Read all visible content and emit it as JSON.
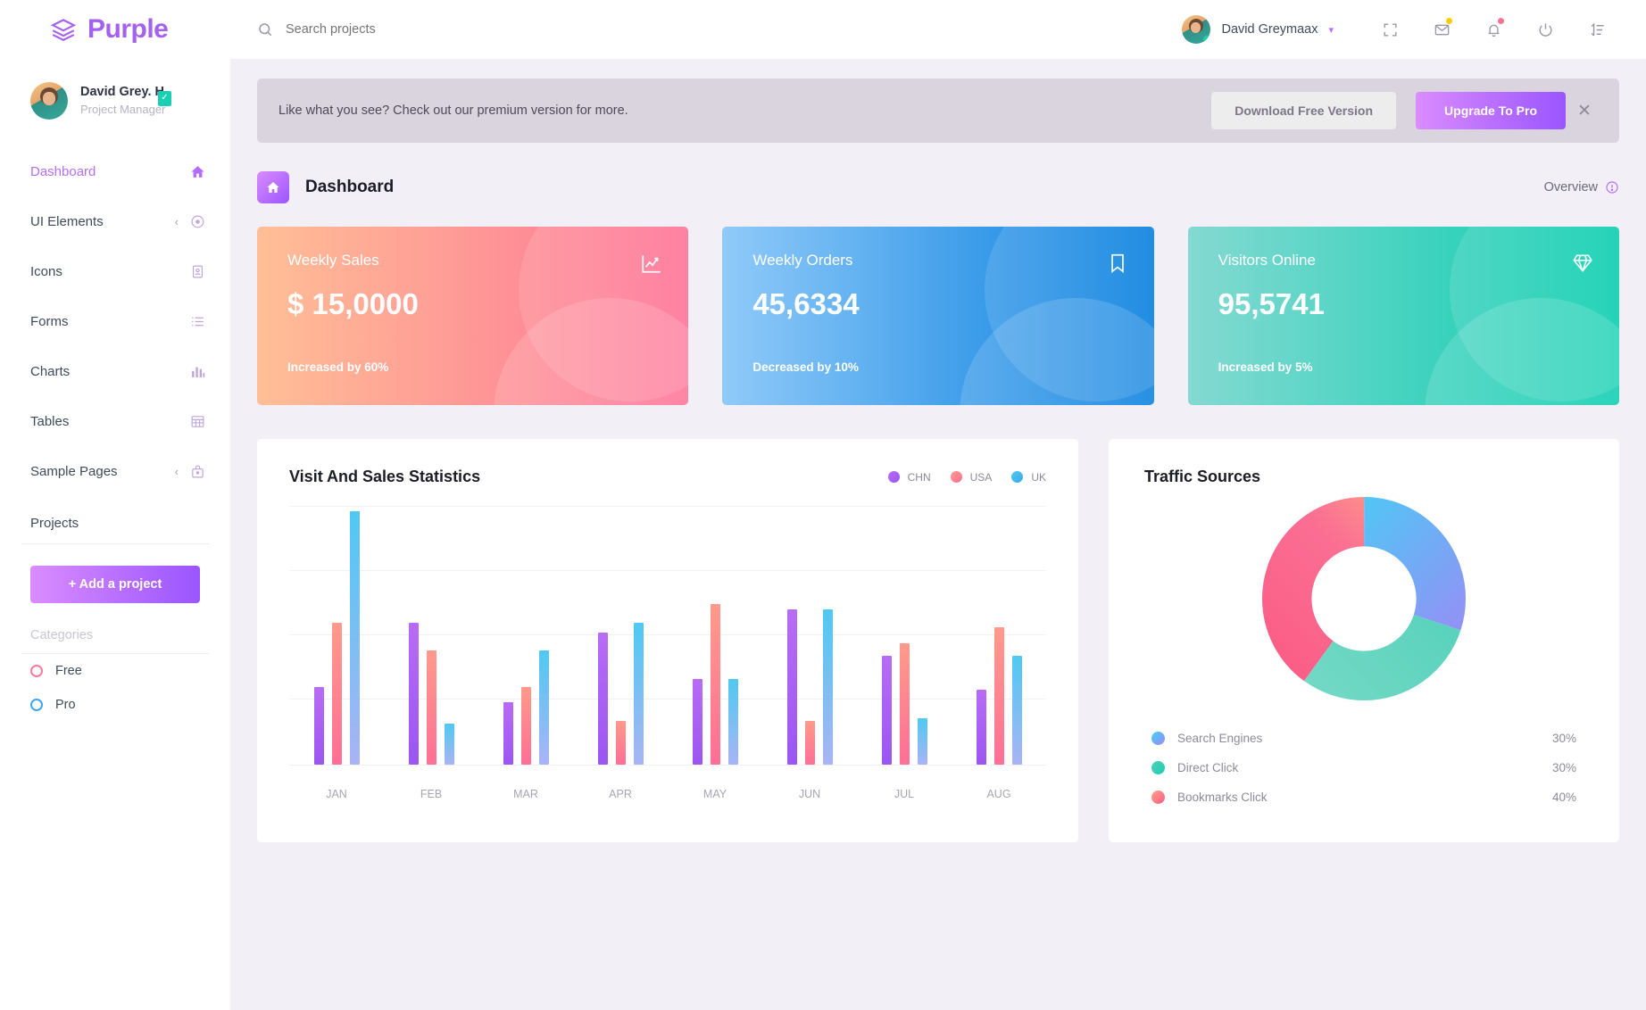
{
  "brand": {
    "name": "Purple",
    "logo_icon": "layers-icon"
  },
  "profile": {
    "name": "David Grey. H",
    "role": "Project Manager",
    "badge_icon": "check-badge-icon"
  },
  "sidebar": {
    "items": [
      {
        "label": "Dashboard",
        "icon": "home-icon",
        "active": true,
        "expandable": false
      },
      {
        "label": "UI Elements",
        "icon": "crosshair-icon",
        "active": false,
        "expandable": true
      },
      {
        "label": "Icons",
        "icon": "contact-card-icon",
        "active": false,
        "expandable": false
      },
      {
        "label": "Forms",
        "icon": "list-icon",
        "active": false,
        "expandable": false
      },
      {
        "label": "Charts",
        "icon": "bar-chart-icon",
        "active": false,
        "expandable": false
      },
      {
        "label": "Tables",
        "icon": "table-grid-icon",
        "active": false,
        "expandable": false
      },
      {
        "label": "Sample Pages",
        "icon": "lock-bag-icon",
        "active": false,
        "expandable": true
      }
    ],
    "projects_label": "Projects",
    "add_project_label": "+ Add a project",
    "categories_label": "Categories",
    "categories": [
      {
        "label": "Free",
        "color": "#fe7c96"
      },
      {
        "label": "Pro",
        "color": "#3da5f4"
      }
    ]
  },
  "topbar": {
    "search_placeholder": "Search projects",
    "search_value": "",
    "search_icon": "search-icon",
    "user_name": "David Greymaax",
    "icons": [
      {
        "name": "fullscreen-icon",
        "badge": null
      },
      {
        "name": "mail-icon",
        "badge": "#ffcc00"
      },
      {
        "name": "bell-icon",
        "badge": "#fe7096"
      },
      {
        "name": "power-icon",
        "badge": null
      },
      {
        "name": "sort-list-icon",
        "badge": null
      }
    ]
  },
  "promo": {
    "text": "Like what you see? Check out our premium version for more.",
    "free_button": "Download Free Version",
    "pro_button": "Upgrade To Pro",
    "close_icon": "close-icon"
  },
  "page": {
    "title": "Dashboard",
    "icon": "home-icon",
    "overview_label": "Overview",
    "overview_icon": "info-circle-icon"
  },
  "stat_cards": [
    {
      "title": "Weekly Sales",
      "value": "$ 15,0000",
      "delta": "Increased by 60%",
      "icon": "line-chart-icon",
      "gradient_from": "#ffbf96",
      "gradient_to": "#fe7096"
    },
    {
      "title": "Weekly Orders",
      "value": "45,6334",
      "delta": "Decreased by 10%",
      "icon": "bookmark-icon",
      "gradient_from": "#90caf9",
      "gradient_to": "#047edf"
    },
    {
      "title": "Visitors Online",
      "value": "95,5741",
      "delta": "Increased by 5%",
      "icon": "diamond-icon",
      "gradient_from": "#84d9d2",
      "gradient_to": "#07cdae"
    }
  ],
  "chart_data": [
    {
      "type": "bar",
      "title": "Visit And Sales Statistics",
      "categories": [
        "JAN",
        "FEB",
        "MAR",
        "APR",
        "MAY",
        "JUN",
        "JUL",
        "AUG"
      ],
      "series": [
        {
          "name": "CHN",
          "color": "#9b55f2",
          "values": [
            30,
            55,
            24,
            51,
            33,
            60,
            42,
            29
          ]
        },
        {
          "name": "USA",
          "color": "#fe7096",
          "values": [
            55,
            44,
            30,
            17,
            62,
            17,
            47,
            53
          ]
        },
        {
          "name": "UK",
          "color": "#4fc9f2",
          "values": [
            98,
            16,
            44,
            55,
            33,
            60,
            18,
            42
          ]
        }
      ],
      "ylim": [
        0,
        100
      ],
      "xlabel": "",
      "ylabel": "",
      "grid": true,
      "legend_position": "top-right"
    },
    {
      "type": "pie",
      "title": "Traffic Sources",
      "labels": [
        "Search Engines",
        "Direct Click",
        "Bookmarks Click"
      ],
      "values": [
        30,
        30,
        40
      ],
      "value_labels": [
        "30%",
        "30%",
        "40%"
      ],
      "colors": [
        "#4fc9f2",
        "#1bcfb4",
        "#fe7096"
      ],
      "donut": true,
      "legend_position": "bottom"
    }
  ]
}
